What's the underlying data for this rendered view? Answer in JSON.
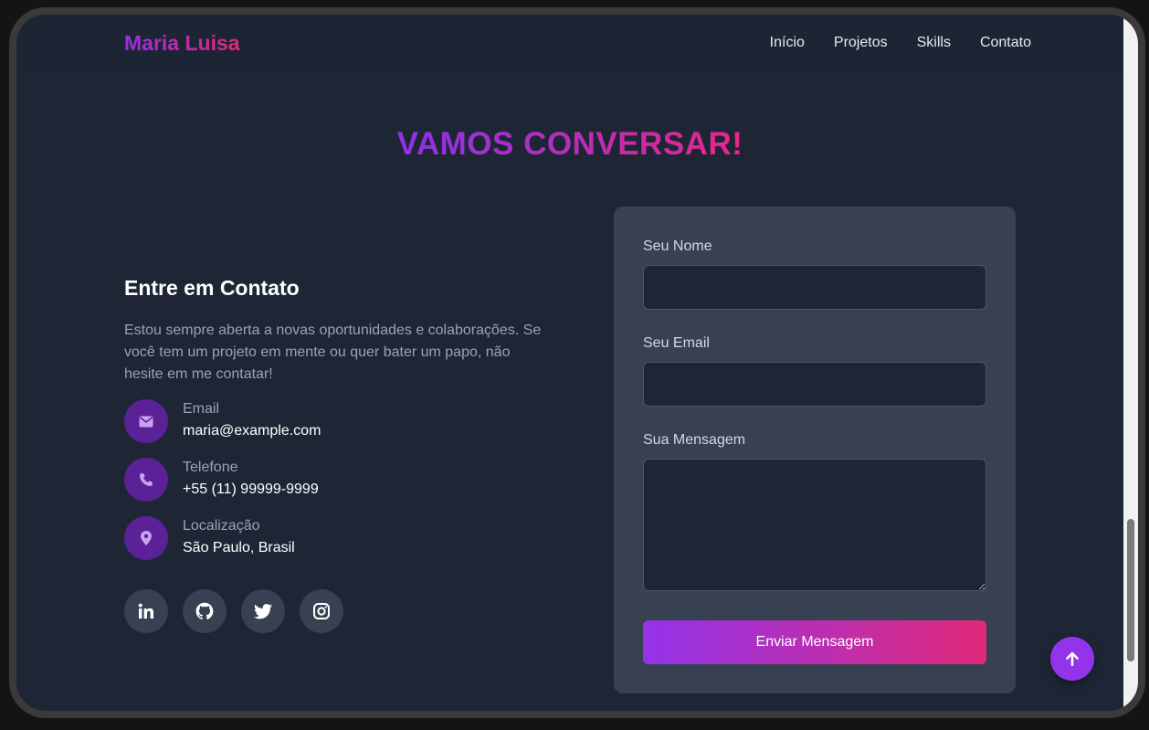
{
  "header": {
    "brand": "Maria Luisa",
    "nav": [
      "Início",
      "Projetos",
      "Skills",
      "Contato"
    ]
  },
  "section": {
    "title": "VAMOS CONVERSAR!"
  },
  "contact": {
    "heading": "Entre em Contato",
    "description": "Estou sempre aberta a novas oportunidades e colaborações. Se você tem um projeto em mente ou quer bater um papo, não hesite em me contatar!",
    "items": [
      {
        "icon": "envelope-icon",
        "label": "Email",
        "value": "maria@example.com"
      },
      {
        "icon": "phone-icon",
        "label": "Telefone",
        "value": "+55 (11) 99999-9999"
      },
      {
        "icon": "map-pin-icon",
        "label": "Localização",
        "value": "São Paulo, Brasil"
      }
    ],
    "socials": [
      "linkedin-icon",
      "github-icon",
      "twitter-icon",
      "instagram-icon"
    ]
  },
  "form": {
    "name_label": "Seu Nome",
    "name_value": "",
    "email_label": "Seu Email",
    "email_value": "",
    "message_label": "Sua Mensagem",
    "message_value": "",
    "submit": "Enviar Mensagem"
  },
  "colors": {
    "background": "#1e2636",
    "card": "#374151",
    "accent_start": "#9333ea",
    "accent_end": "#e02a7b",
    "icon_circle": "#5b2196"
  }
}
